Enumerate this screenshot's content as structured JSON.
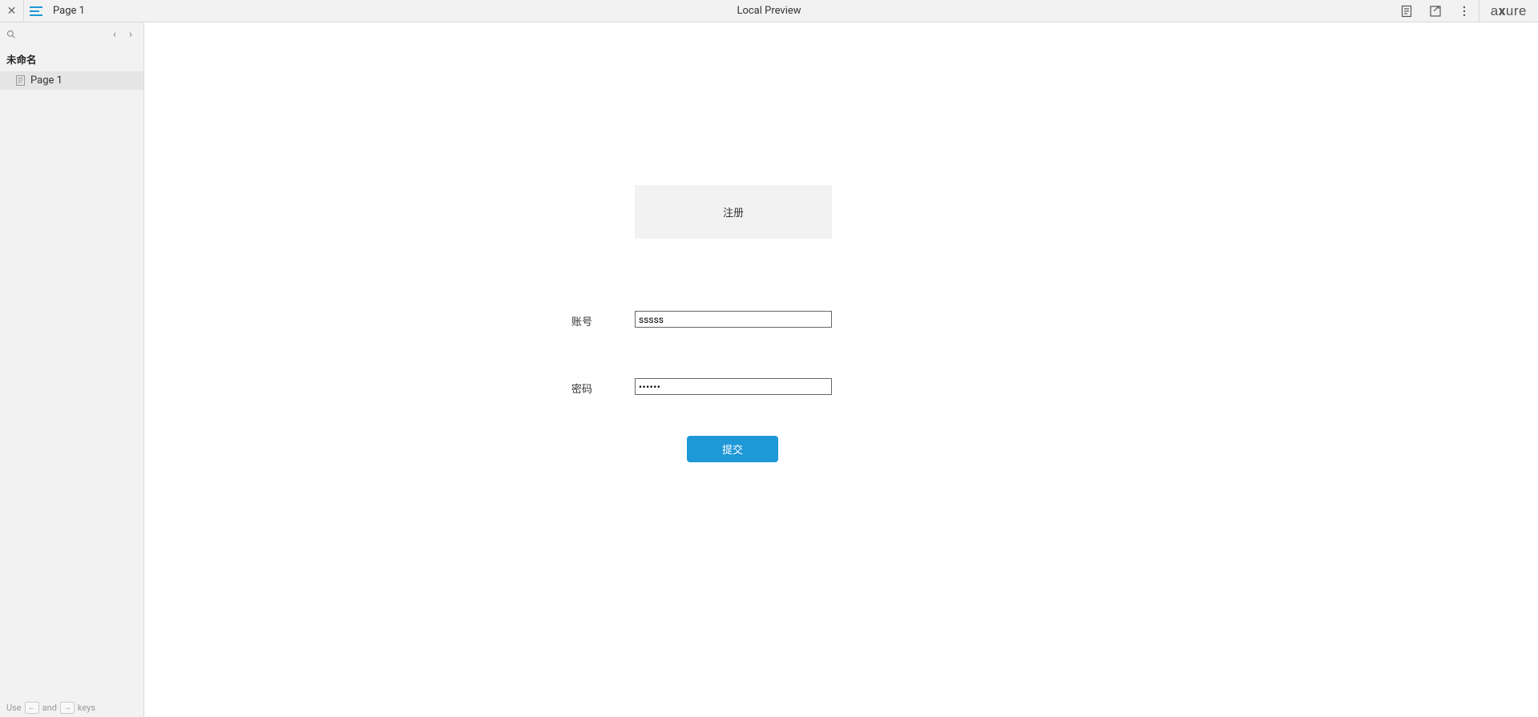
{
  "topbar": {
    "page_name": "Page 1",
    "center_title": "Local Preview",
    "logo": "axure"
  },
  "sidebar": {
    "project_title": "未命名",
    "pages": [
      {
        "label": "Page 1"
      }
    ],
    "hint": {
      "use": "Use",
      "and": "and",
      "keys": "keys",
      "left": "←",
      "right": "→"
    }
  },
  "form": {
    "header": "注册",
    "account_label": "账号",
    "password_label": "密码",
    "account_value": "sssss",
    "password_value": "••••••",
    "submit_label": "提交"
  }
}
